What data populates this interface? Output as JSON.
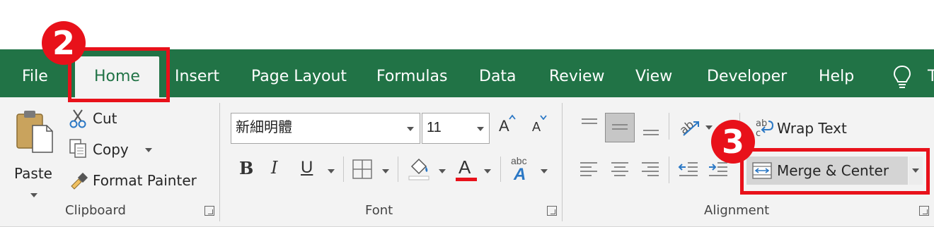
{
  "tabs": {
    "file": "File",
    "home": "Home",
    "insert": "Insert",
    "page_layout": "Page Layout",
    "formulas": "Formulas",
    "data": "Data",
    "review": "Review",
    "view": "View",
    "developer": "Developer",
    "help": "Help",
    "tell_me_partial": "T"
  },
  "clipboard": {
    "paste": "Paste",
    "cut": "Cut",
    "copy": "Copy",
    "format_painter": "Format Painter",
    "group_label": "Clipboard"
  },
  "font": {
    "font_name": "新細明體",
    "font_size": "11",
    "bold": "B",
    "italic": "I",
    "underline": "U",
    "font_color_letter": "A",
    "grow_letter": "A",
    "shrink_letter": "A",
    "phonetic_top": "abc",
    "phonetic_letter": "A",
    "group_label": "Font"
  },
  "alignment": {
    "wrap_text": "Wrap Text",
    "merge_center": "Merge & Center",
    "wrap_icon_text": "ab",
    "group_label": "Alignment"
  },
  "markers": {
    "step2": "2",
    "step3": "3"
  },
  "colors": {
    "excel_green": "#217346",
    "marker_red": "#e8111a",
    "font_color_bar": "#e8111a",
    "icon_blue": "#2b78c5"
  },
  "icons": [
    "paste-icon",
    "scissors-icon",
    "copy-icon",
    "format-painter-icon",
    "borders-icon",
    "fill-color-icon",
    "font-color-icon",
    "grow-font-icon",
    "shrink-font-icon",
    "phonetic-icon",
    "align-top-icon",
    "align-middle-icon",
    "align-bottom-icon",
    "orientation-icon",
    "align-left-icon",
    "align-center-icon",
    "align-right-icon",
    "decrease-indent-icon",
    "increase-indent-icon",
    "wrap-text-icon",
    "merge-center-icon",
    "lightbulb-icon",
    "dialog-launcher-icon"
  ]
}
